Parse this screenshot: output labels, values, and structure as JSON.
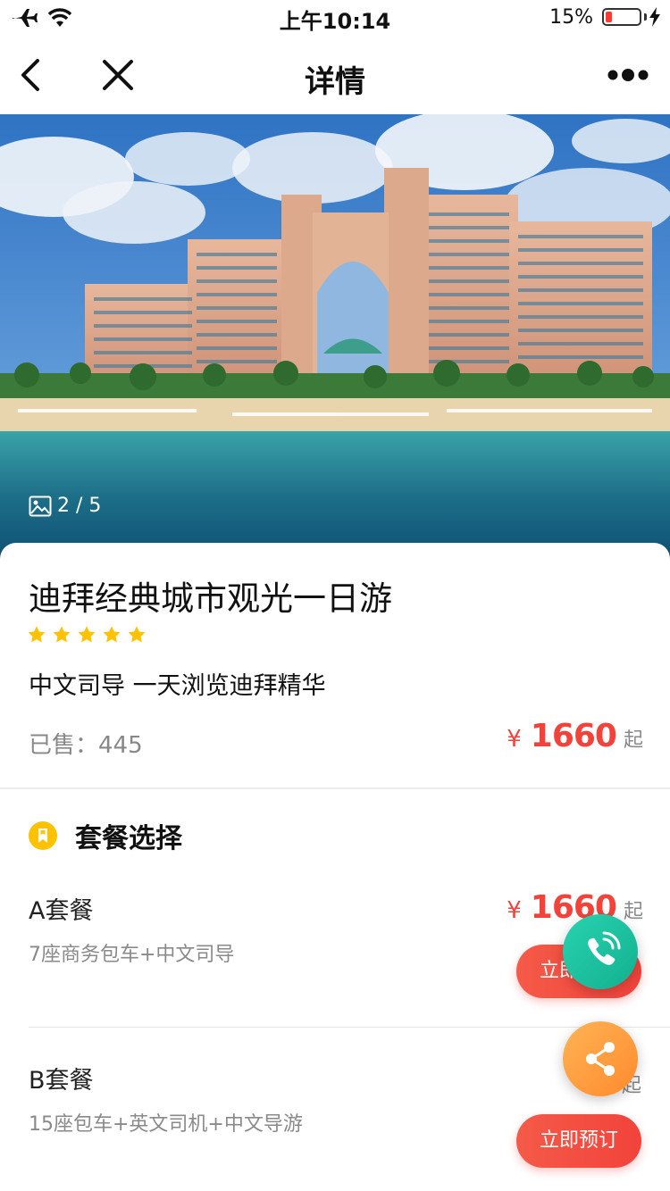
{
  "status_bar": {
    "time": "上午10:14",
    "battery": "15%",
    "icons": [
      "airplane-icon",
      "wifi-icon",
      "battery-icon",
      "charging-icon"
    ]
  },
  "nav": {
    "title": "详情",
    "icons": [
      "back-icon",
      "close-icon",
      "more-icon"
    ]
  },
  "gallery": {
    "counter": "2 / 5",
    "icon": "image-icon"
  },
  "product": {
    "title": "迪拜经典城市观光一日游",
    "rating": 5,
    "subtitle": "中文司导 一天浏览迪拜精华",
    "sold_label": "已售：",
    "sold_count": "445",
    "price": {
      "currency": "¥",
      "amount": "1660",
      "suffix": "起"
    }
  },
  "packages": {
    "section_title": "套餐选择",
    "section_icon": "bookmark-icon",
    "items": [
      {
        "name": "A套餐",
        "desc": "7座商务包车+中文司导",
        "price_currency": "¥",
        "price_amount": "1660",
        "price_suffix": "起",
        "book_label": "立即预订"
      },
      {
        "name": "B套餐",
        "desc": "15座包车+英文司机+中文导游",
        "price_suffix": "起",
        "book_label": "立即预订"
      }
    ]
  },
  "floating_buttons": [
    "phone-icon",
    "share-icon"
  ],
  "colors": {
    "accent_red": "#f2433b",
    "star_yellow": "#ffc200",
    "phone_green": "#1fc39f",
    "share_orange": "#ff9a3c"
  }
}
